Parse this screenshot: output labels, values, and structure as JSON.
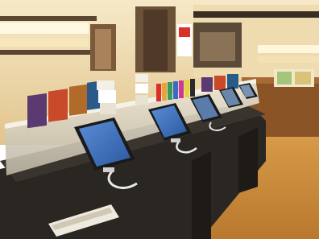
{
  "scene": {
    "subject": "electronics-store-tablet-display-counter",
    "palette": {
      "wall_warm": "#e8d2a0",
      "wall_light": "#f4e6c3",
      "ceiling_light": "#fff6dc",
      "floor": "#c98a3a",
      "counter_dark": "#2a2622",
      "counter_edge": "#3a342e",
      "glass_riser": "#d9d3c4",
      "tablet_screen": "#3d6fb8",
      "tablet_body": "#1a1a1a",
      "cable": "#e8e8e8",
      "side_counter_wood": "#8a5427",
      "doorway": "#7a5a3a"
    },
    "icons": [
      "tablet-icon",
      "book-icon",
      "cable-icon"
    ]
  }
}
